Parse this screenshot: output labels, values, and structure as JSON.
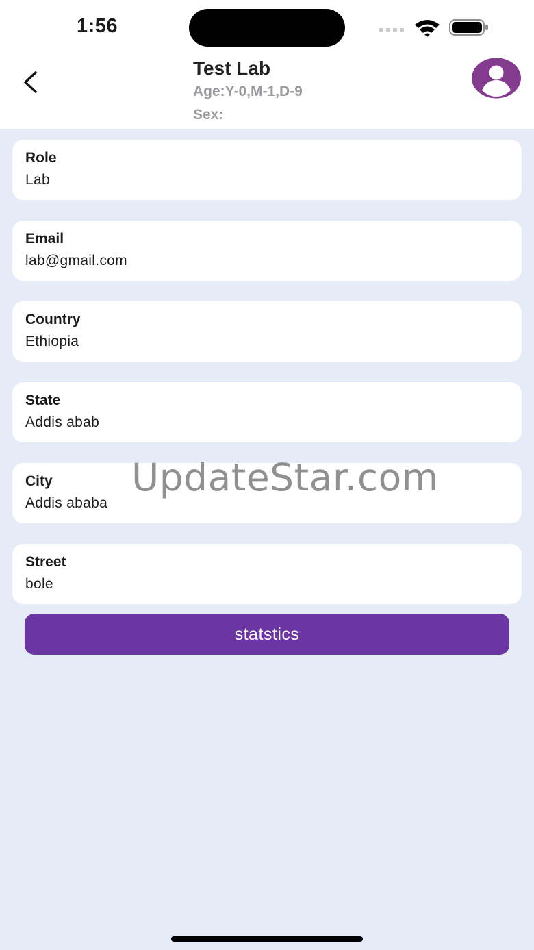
{
  "status_bar": {
    "time": "1:56"
  },
  "header": {
    "title": "Test Lab",
    "age": "Age:Y-0,M-1,D-9",
    "sex": "Sex:",
    "back_icon": "chevron-left-icon",
    "avatar_icon": "user-avatar-icon"
  },
  "cards": [
    {
      "label": "Role",
      "value": "Lab"
    },
    {
      "label": "Email",
      "value": "lab@gmail.com"
    },
    {
      "label": "Country",
      "value": "Ethiopia"
    },
    {
      "label": "State",
      "value": "Addis abab"
    },
    {
      "label": "City",
      "value": "Addis ababa"
    },
    {
      "label": "Street",
      "value": "bole"
    }
  ],
  "statistics_button": {
    "label": "statstics"
  },
  "watermark": "UpdateStar.com",
  "colors": {
    "accent": "#6c35a4",
    "avatar": "#843b8f",
    "background": "#e6ecf7",
    "card": "#ffffff",
    "muted_text": "#9a9a9e"
  }
}
